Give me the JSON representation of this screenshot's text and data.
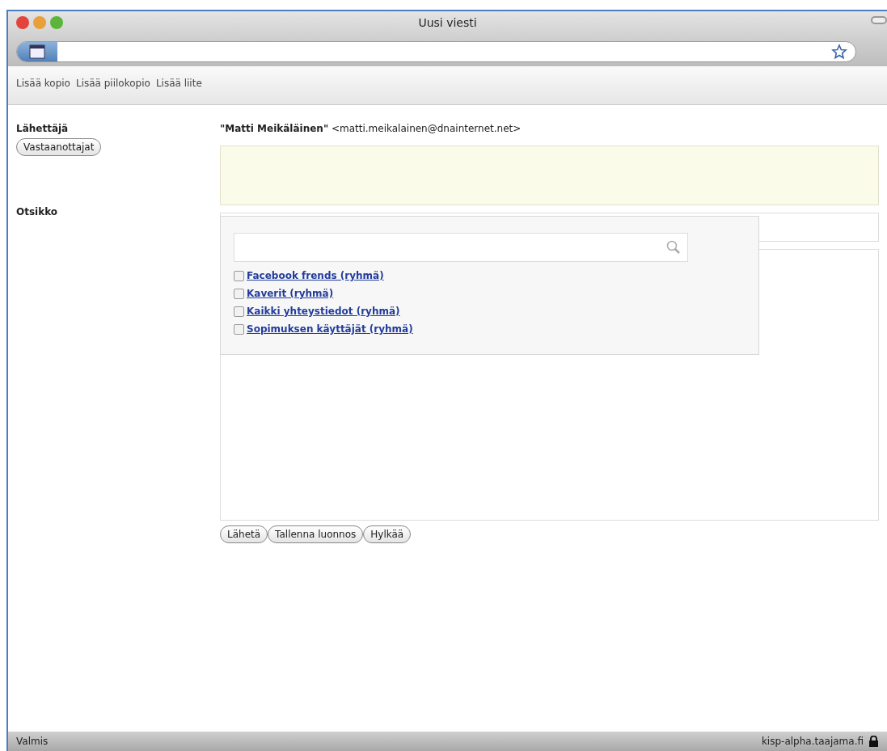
{
  "window": {
    "title": "Uusi viesti"
  },
  "toolbar": [
    "Lisää kopio",
    "Lisää piilokopio",
    "Lisää liite"
  ],
  "sender": {
    "label": "Lähettäjä",
    "name": "\"Matti Meikäläinen\"",
    "address": "<matti.meikalainen@dnainternet.net>"
  },
  "recipients_button": "Vastaanottajat",
  "subject_label": "Otsikko",
  "dropdown": {
    "groups": [
      {
        "label": "Facebook frends (ryhmä)",
        "checked": false
      },
      {
        "label": "Kaverit (ryhmä)",
        "checked": false
      },
      {
        "label": "Kaikki yhteystiedot (ryhmä)",
        "checked": false
      },
      {
        "label": "Sopimuksen käyttäjät (ryhmä)",
        "checked": false
      }
    ]
  },
  "buttons": [
    "Lähetä",
    "Tallenna luonnos",
    "Hylkää"
  ],
  "status_bar": {
    "text": "Valmis",
    "host": "kisp-alpha.taajama.fi"
  }
}
